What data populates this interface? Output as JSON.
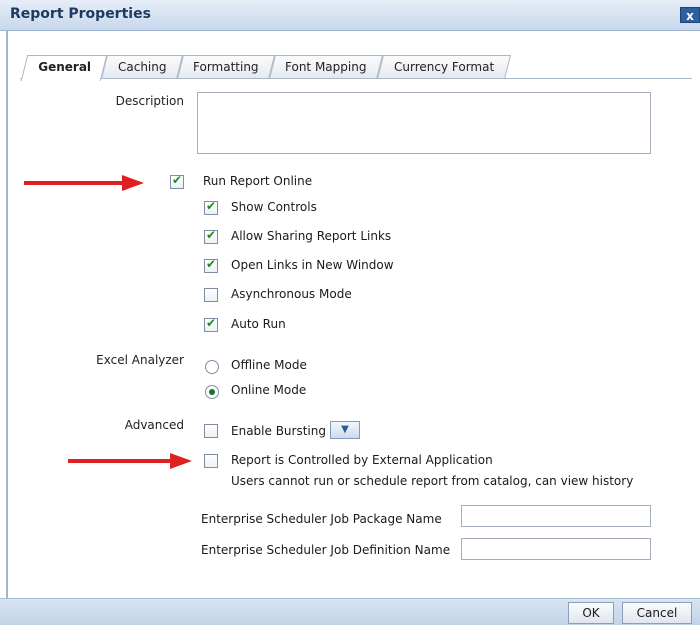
{
  "window": {
    "title": "Report Properties",
    "close_label": "x"
  },
  "tabs": [
    {
      "label": "General",
      "active": true
    },
    {
      "label": "Caching",
      "active": false
    },
    {
      "label": "Formatting",
      "active": false
    },
    {
      "label": "Font Mapping",
      "active": false
    },
    {
      "label": "Currency Format",
      "active": false
    }
  ],
  "form": {
    "description_label": "Description",
    "description_value": "",
    "run_online": {
      "label": "Run Report Online",
      "checked": true
    },
    "options": [
      {
        "label": "Show Controls",
        "checked": true
      },
      {
        "label": "Allow Sharing Report Links",
        "checked": true
      },
      {
        "label": "Open Links in New Window",
        "checked": true
      },
      {
        "label": "Asynchronous Mode",
        "checked": false
      },
      {
        "label": "Auto Run",
        "checked": true
      }
    ],
    "excel_analyzer": {
      "label": "Excel Analyzer",
      "options": [
        {
          "label": "Offline Mode",
          "selected": false
        },
        {
          "label": "Online Mode",
          "selected": true
        }
      ]
    },
    "advanced": {
      "label": "Advanced",
      "enable_bursting": {
        "label": "Enable Bursting",
        "checked": false
      },
      "external_app": {
        "label": "Report is Controlled by External Application",
        "checked": false,
        "note": "Users cannot run or schedule report from catalog, can view history"
      },
      "job_package": {
        "label": "Enterprise Scheduler Job Package Name",
        "value": ""
      },
      "job_definition": {
        "label": "Enterprise Scheduler Job Definition Name",
        "value": ""
      }
    }
  },
  "footer": {
    "ok_label": "OK",
    "cancel_label": "Cancel"
  },
  "colors": {
    "annotation_arrow": "#e02020",
    "checkmark": "#1c8a1c"
  }
}
